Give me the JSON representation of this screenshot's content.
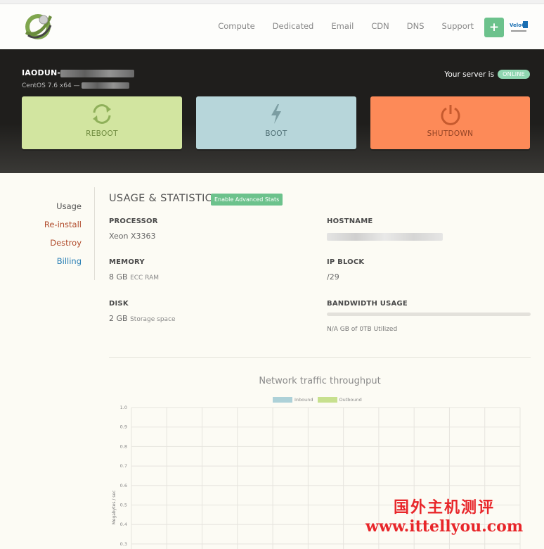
{
  "nav": {
    "items": [
      "Compute",
      "Dedicated",
      "Email",
      "CDN",
      "DNS",
      "Support"
    ],
    "plus_label": "+",
    "brand_text": "VeloC"
  },
  "server": {
    "name_prefix": "IAODUN-",
    "os_prefix": "CentOS 7.6 x64 —",
    "status_text": "Your server is",
    "status_badge": "ONLINE"
  },
  "actions": {
    "reboot": "REBOOT",
    "boot": "BOOT",
    "shutdown": "SHUTDOWN"
  },
  "sidemenu": {
    "usage": "Usage",
    "reinstall": "Re-install",
    "destroy": "Destroy",
    "billing": "Billing"
  },
  "stats": {
    "title": "USAGE & STATISTICS",
    "advanced_button": "Enable Advanced Stats",
    "processor_label": "PROCESSOR",
    "processor_value": "Xeon X3363",
    "hostname_label": "HOSTNAME",
    "memory_label": "MEMORY",
    "memory_value": "8 GB",
    "memory_sub": "ECC RAM",
    "ipblock_label": "IP BLOCK",
    "ipblock_value": "/29",
    "disk_label": "DISK",
    "disk_value": "2 GB",
    "disk_sub": "Storage space",
    "bandwidth_label": "BANDWIDTH USAGE",
    "bandwidth_text": "N/A GB of 0TB Utilized",
    "bandwidth_fraction": 0
  },
  "colors": {
    "inbound": "#add1d8",
    "outbound": "#c7e08e",
    "accent": "#6cc28c"
  },
  "chart_data": {
    "type": "line",
    "title": "Network traffic throughput",
    "ylabel": "Megabytes / sec",
    "xlabel": "",
    "ylim": [
      0,
      1.0
    ],
    "yticks": [
      "1.0",
      "0.9",
      "0.8",
      "0.7",
      "0.6",
      "0.5",
      "0.4",
      "0.3"
    ],
    "series": [
      {
        "name": "Inbound",
        "values": []
      },
      {
        "name": "Outbound",
        "values": []
      }
    ],
    "grid": true,
    "legend": "top-center"
  },
  "watermark": {
    "line1": "国外主机测评",
    "line2": "www.ittellyou.com"
  }
}
